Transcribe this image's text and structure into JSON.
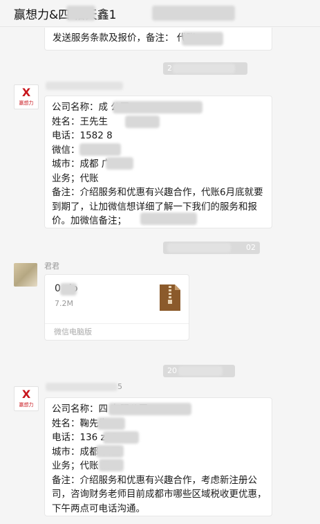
{
  "header": {
    "title": "赢想力&四      怡天鑫1"
  },
  "messages": [
    {
      "lines": [
        "发送服务条款及报价，备注：           代账"
      ]
    },
    {
      "timestamp": "2",
      "sender": "",
      "lines": [
        "公司名称：成                           公司",
        "姓名：王先生",
        "电话：1582        8",
        "微信：          7738",
        "城市：成都 广",
        "业务；代账",
        "备注：介绍服务和优惠有兴趣合作，代账6月底就要到期了，让加微信想详细了解一下我们的服务和报价。加微信备注；"
      ]
    },
    {
      "timestamp": "02",
      "sender": "君君",
      "file": {
        "name": "0   zip",
        "size": "7.2M",
        "source": "微信电脑版"
      }
    },
    {
      "timestamp": "20",
      "sender": "5",
      "lines": [
        "公司名称：四                     有限公司",
        "姓名：鞠先生",
        "电话：136       z1799",
        "城市：成都      侯区",
        "业务；代账    册",
        "备注：介绍服务和优惠有兴趣合作，考虑新注册公司，咨询财务老师目前成都市哪些区域税收更优惠，下午两点可电话沟通。"
      ]
    }
  ],
  "avatars": {
    "logo_text": "赢想力",
    "logo_mark": "X"
  },
  "colors": {
    "logo_red": "#c8161d",
    "zip_brown": "#8b5a2b"
  }
}
